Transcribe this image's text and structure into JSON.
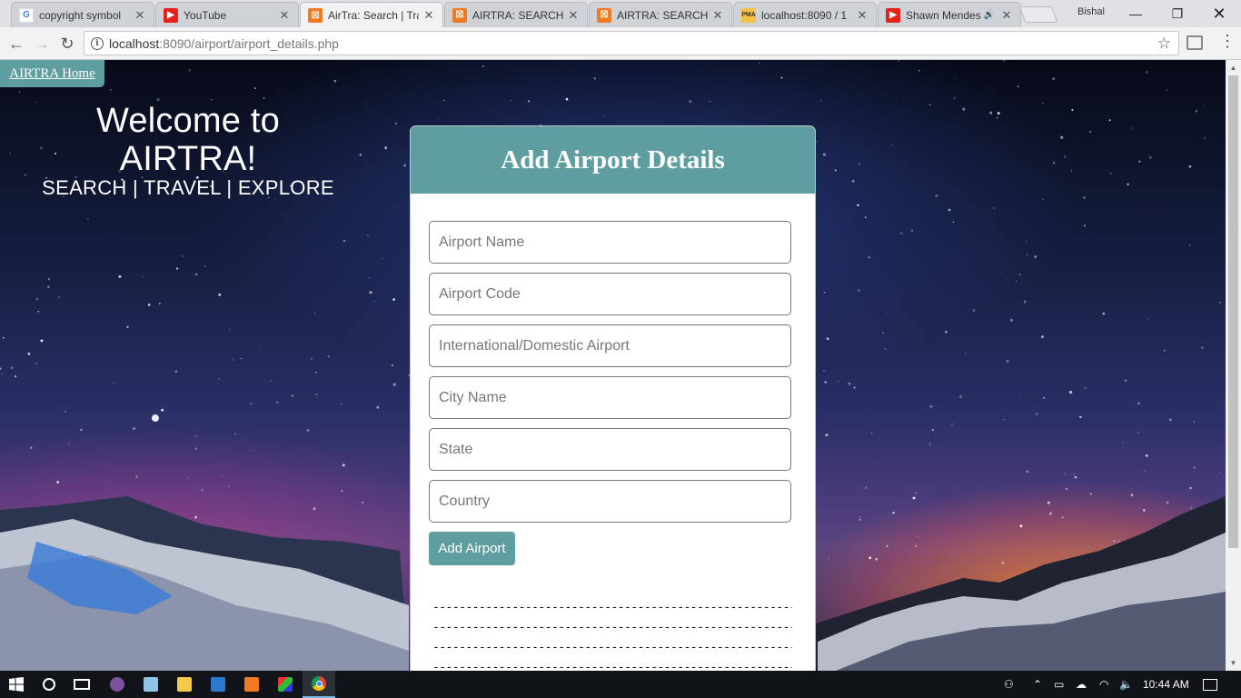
{
  "browser": {
    "tabs": [
      {
        "label": "copyright symbol",
        "favicon": "google-icon"
      },
      {
        "label": "YouTube",
        "favicon": "youtube-icon"
      },
      {
        "label": "AirTra: Search | Tra",
        "favicon": "xampp-icon",
        "active": true
      },
      {
        "label": "AIRTRA: SEARCH |",
        "favicon": "xampp-icon"
      },
      {
        "label": "AIRTRA: SEARCH |",
        "favicon": "xampp-icon"
      },
      {
        "label": "localhost:8090 / 1",
        "favicon": "phpmyadmin-icon"
      },
      {
        "label": "Shawn Mendes",
        "favicon": "youtube-icon",
        "audio": true
      }
    ],
    "profile_name": "Bishal",
    "url_host": "localhost",
    "url_rest": ":8090/airport/airport_details.php"
  },
  "page": {
    "home_link": "AIRTRA Home",
    "welcome_title": "Welcome to AIRTRA!",
    "welcome_subtitle": "SEARCH | TRAVEL | EXPLORE",
    "form": {
      "title": "Add Airport Details",
      "fields": [
        {
          "placeholder": "Airport Name",
          "value": ""
        },
        {
          "placeholder": "Airport Code",
          "value": ""
        },
        {
          "placeholder": "International/Domestic Airport",
          "value": ""
        },
        {
          "placeholder": "City Name",
          "value": ""
        },
        {
          "placeholder": "State",
          "value": ""
        },
        {
          "placeholder": "Country",
          "value": ""
        }
      ],
      "submit_label": "Add Airport",
      "dividers": [
        "----------------------------------------------------------------------",
        "----------------------------------------------------------------------",
        "----------------------------------------------------------------------",
        "----------------------------------------------------------------------"
      ]
    },
    "accent_color": "#5f9ea0"
  },
  "taskbar": {
    "clock": "10:44 AM",
    "apps": [
      "windows-start-icon",
      "cortana-icon",
      "task-view-icon",
      "viber-icon",
      "notepad-icon",
      "file-explorer-icon",
      "outlook-icon",
      "xampp-icon",
      "paint-icon",
      "chrome-icon"
    ]
  }
}
